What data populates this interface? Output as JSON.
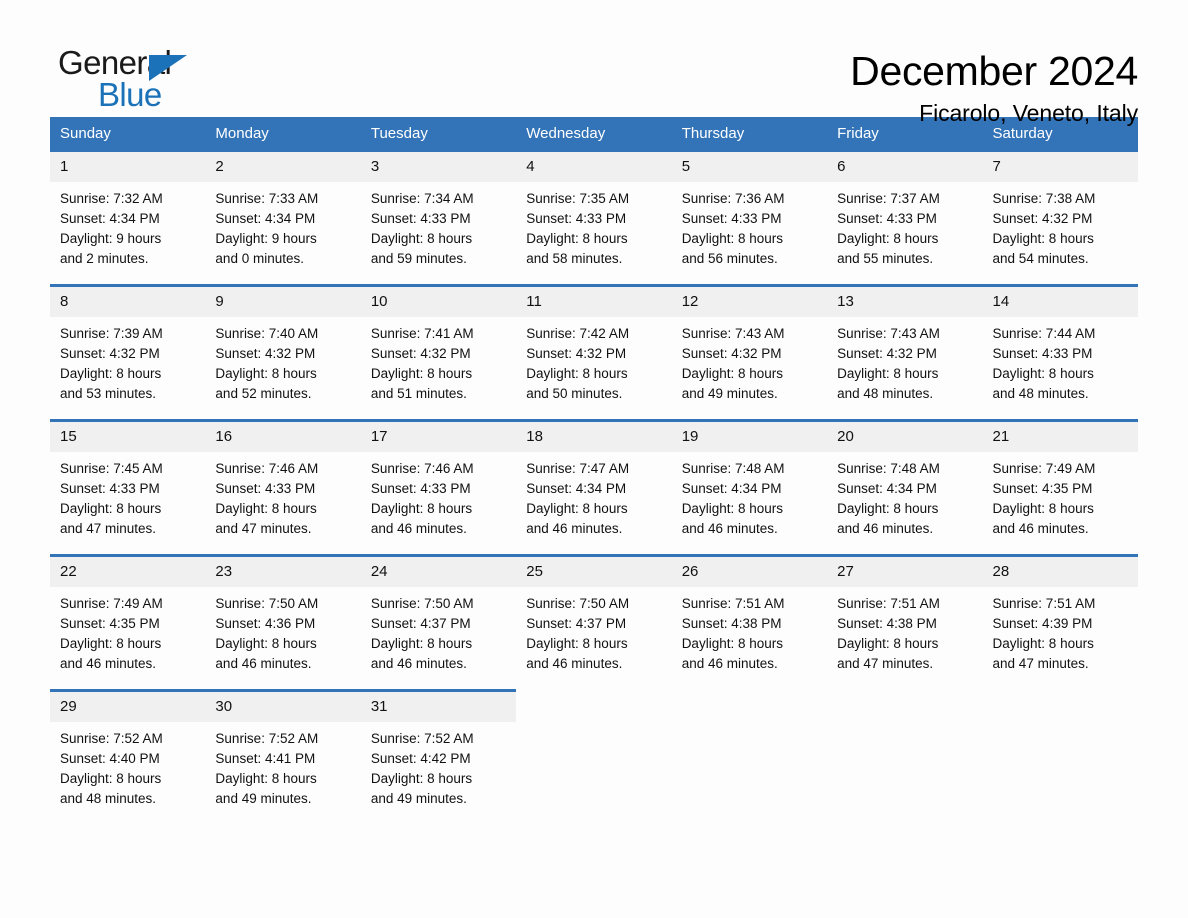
{
  "brand": {
    "name_part1": "General",
    "name_part2": "Blue",
    "accent_color": "#1b72b8"
  },
  "header": {
    "month_title": "December 2024",
    "location": "Ficarolo, Veneto, Italy",
    "header_bg_color": "#3374b8",
    "day_band_color": "#f0f0f0"
  },
  "weekdays": [
    "Sunday",
    "Monday",
    "Tuesday",
    "Wednesday",
    "Thursday",
    "Friday",
    "Saturday"
  ],
  "weeks": [
    [
      {
        "day": "1",
        "sunrise": "Sunrise: 7:32 AM",
        "sunset": "Sunset: 4:34 PM",
        "daylight_line1": "Daylight: 9 hours",
        "daylight_line2": "and 2 minutes."
      },
      {
        "day": "2",
        "sunrise": "Sunrise: 7:33 AM",
        "sunset": "Sunset: 4:34 PM",
        "daylight_line1": "Daylight: 9 hours",
        "daylight_line2": "and 0 minutes."
      },
      {
        "day": "3",
        "sunrise": "Sunrise: 7:34 AM",
        "sunset": "Sunset: 4:33 PM",
        "daylight_line1": "Daylight: 8 hours",
        "daylight_line2": "and 59 minutes."
      },
      {
        "day": "4",
        "sunrise": "Sunrise: 7:35 AM",
        "sunset": "Sunset: 4:33 PM",
        "daylight_line1": "Daylight: 8 hours",
        "daylight_line2": "and 58 minutes."
      },
      {
        "day": "5",
        "sunrise": "Sunrise: 7:36 AM",
        "sunset": "Sunset: 4:33 PM",
        "daylight_line1": "Daylight: 8 hours",
        "daylight_line2": "and 56 minutes."
      },
      {
        "day": "6",
        "sunrise": "Sunrise: 7:37 AM",
        "sunset": "Sunset: 4:33 PM",
        "daylight_line1": "Daylight: 8 hours",
        "daylight_line2": "and 55 minutes."
      },
      {
        "day": "7",
        "sunrise": "Sunrise: 7:38 AM",
        "sunset": "Sunset: 4:32 PM",
        "daylight_line1": "Daylight: 8 hours",
        "daylight_line2": "and 54 minutes."
      }
    ],
    [
      {
        "day": "8",
        "sunrise": "Sunrise: 7:39 AM",
        "sunset": "Sunset: 4:32 PM",
        "daylight_line1": "Daylight: 8 hours",
        "daylight_line2": "and 53 minutes."
      },
      {
        "day": "9",
        "sunrise": "Sunrise: 7:40 AM",
        "sunset": "Sunset: 4:32 PM",
        "daylight_line1": "Daylight: 8 hours",
        "daylight_line2": "and 52 minutes."
      },
      {
        "day": "10",
        "sunrise": "Sunrise: 7:41 AM",
        "sunset": "Sunset: 4:32 PM",
        "daylight_line1": "Daylight: 8 hours",
        "daylight_line2": "and 51 minutes."
      },
      {
        "day": "11",
        "sunrise": "Sunrise: 7:42 AM",
        "sunset": "Sunset: 4:32 PM",
        "daylight_line1": "Daylight: 8 hours",
        "daylight_line2": "and 50 minutes."
      },
      {
        "day": "12",
        "sunrise": "Sunrise: 7:43 AM",
        "sunset": "Sunset: 4:32 PM",
        "daylight_line1": "Daylight: 8 hours",
        "daylight_line2": "and 49 minutes."
      },
      {
        "day": "13",
        "sunrise": "Sunrise: 7:43 AM",
        "sunset": "Sunset: 4:32 PM",
        "daylight_line1": "Daylight: 8 hours",
        "daylight_line2": "and 48 minutes."
      },
      {
        "day": "14",
        "sunrise": "Sunrise: 7:44 AM",
        "sunset": "Sunset: 4:33 PM",
        "daylight_line1": "Daylight: 8 hours",
        "daylight_line2": "and 48 minutes."
      }
    ],
    [
      {
        "day": "15",
        "sunrise": "Sunrise: 7:45 AM",
        "sunset": "Sunset: 4:33 PM",
        "daylight_line1": "Daylight: 8 hours",
        "daylight_line2": "and 47 minutes."
      },
      {
        "day": "16",
        "sunrise": "Sunrise: 7:46 AM",
        "sunset": "Sunset: 4:33 PM",
        "daylight_line1": "Daylight: 8 hours",
        "daylight_line2": "and 47 minutes."
      },
      {
        "day": "17",
        "sunrise": "Sunrise: 7:46 AM",
        "sunset": "Sunset: 4:33 PM",
        "daylight_line1": "Daylight: 8 hours",
        "daylight_line2": "and 46 minutes."
      },
      {
        "day": "18",
        "sunrise": "Sunrise: 7:47 AM",
        "sunset": "Sunset: 4:34 PM",
        "daylight_line1": "Daylight: 8 hours",
        "daylight_line2": "and 46 minutes."
      },
      {
        "day": "19",
        "sunrise": "Sunrise: 7:48 AM",
        "sunset": "Sunset: 4:34 PM",
        "daylight_line1": "Daylight: 8 hours",
        "daylight_line2": "and 46 minutes."
      },
      {
        "day": "20",
        "sunrise": "Sunrise: 7:48 AM",
        "sunset": "Sunset: 4:34 PM",
        "daylight_line1": "Daylight: 8 hours",
        "daylight_line2": "and 46 minutes."
      },
      {
        "day": "21",
        "sunrise": "Sunrise: 7:49 AM",
        "sunset": "Sunset: 4:35 PM",
        "daylight_line1": "Daylight: 8 hours",
        "daylight_line2": "and 46 minutes."
      }
    ],
    [
      {
        "day": "22",
        "sunrise": "Sunrise: 7:49 AM",
        "sunset": "Sunset: 4:35 PM",
        "daylight_line1": "Daylight: 8 hours",
        "daylight_line2": "and 46 minutes."
      },
      {
        "day": "23",
        "sunrise": "Sunrise: 7:50 AM",
        "sunset": "Sunset: 4:36 PM",
        "daylight_line1": "Daylight: 8 hours",
        "daylight_line2": "and 46 minutes."
      },
      {
        "day": "24",
        "sunrise": "Sunrise: 7:50 AM",
        "sunset": "Sunset: 4:37 PM",
        "daylight_line1": "Daylight: 8 hours",
        "daylight_line2": "and 46 minutes."
      },
      {
        "day": "25",
        "sunrise": "Sunrise: 7:50 AM",
        "sunset": "Sunset: 4:37 PM",
        "daylight_line1": "Daylight: 8 hours",
        "daylight_line2": "and 46 minutes."
      },
      {
        "day": "26",
        "sunrise": "Sunrise: 7:51 AM",
        "sunset": "Sunset: 4:38 PM",
        "daylight_line1": "Daylight: 8 hours",
        "daylight_line2": "and 46 minutes."
      },
      {
        "day": "27",
        "sunrise": "Sunrise: 7:51 AM",
        "sunset": "Sunset: 4:38 PM",
        "daylight_line1": "Daylight: 8 hours",
        "daylight_line2": "and 47 minutes."
      },
      {
        "day": "28",
        "sunrise": "Sunrise: 7:51 AM",
        "sunset": "Sunset: 4:39 PM",
        "daylight_line1": "Daylight: 8 hours",
        "daylight_line2": "and 47 minutes."
      }
    ],
    [
      {
        "day": "29",
        "sunrise": "Sunrise: 7:52 AM",
        "sunset": "Sunset: 4:40 PM",
        "daylight_line1": "Daylight: 8 hours",
        "daylight_line2": "and 48 minutes."
      },
      {
        "day": "30",
        "sunrise": "Sunrise: 7:52 AM",
        "sunset": "Sunset: 4:41 PM",
        "daylight_line1": "Daylight: 8 hours",
        "daylight_line2": "and 49 minutes."
      },
      {
        "day": "31",
        "sunrise": "Sunrise: 7:52 AM",
        "sunset": "Sunset: 4:42 PM",
        "daylight_line1": "Daylight: 8 hours",
        "daylight_line2": "and 49 minutes."
      },
      {
        "day": "",
        "sunrise": "",
        "sunset": "",
        "daylight_line1": "",
        "daylight_line2": ""
      },
      {
        "day": "",
        "sunrise": "",
        "sunset": "",
        "daylight_line1": "",
        "daylight_line2": ""
      },
      {
        "day": "",
        "sunrise": "",
        "sunset": "",
        "daylight_line1": "",
        "daylight_line2": ""
      },
      {
        "day": "",
        "sunrise": "",
        "sunset": "",
        "daylight_line1": "",
        "daylight_line2": ""
      }
    ]
  ]
}
